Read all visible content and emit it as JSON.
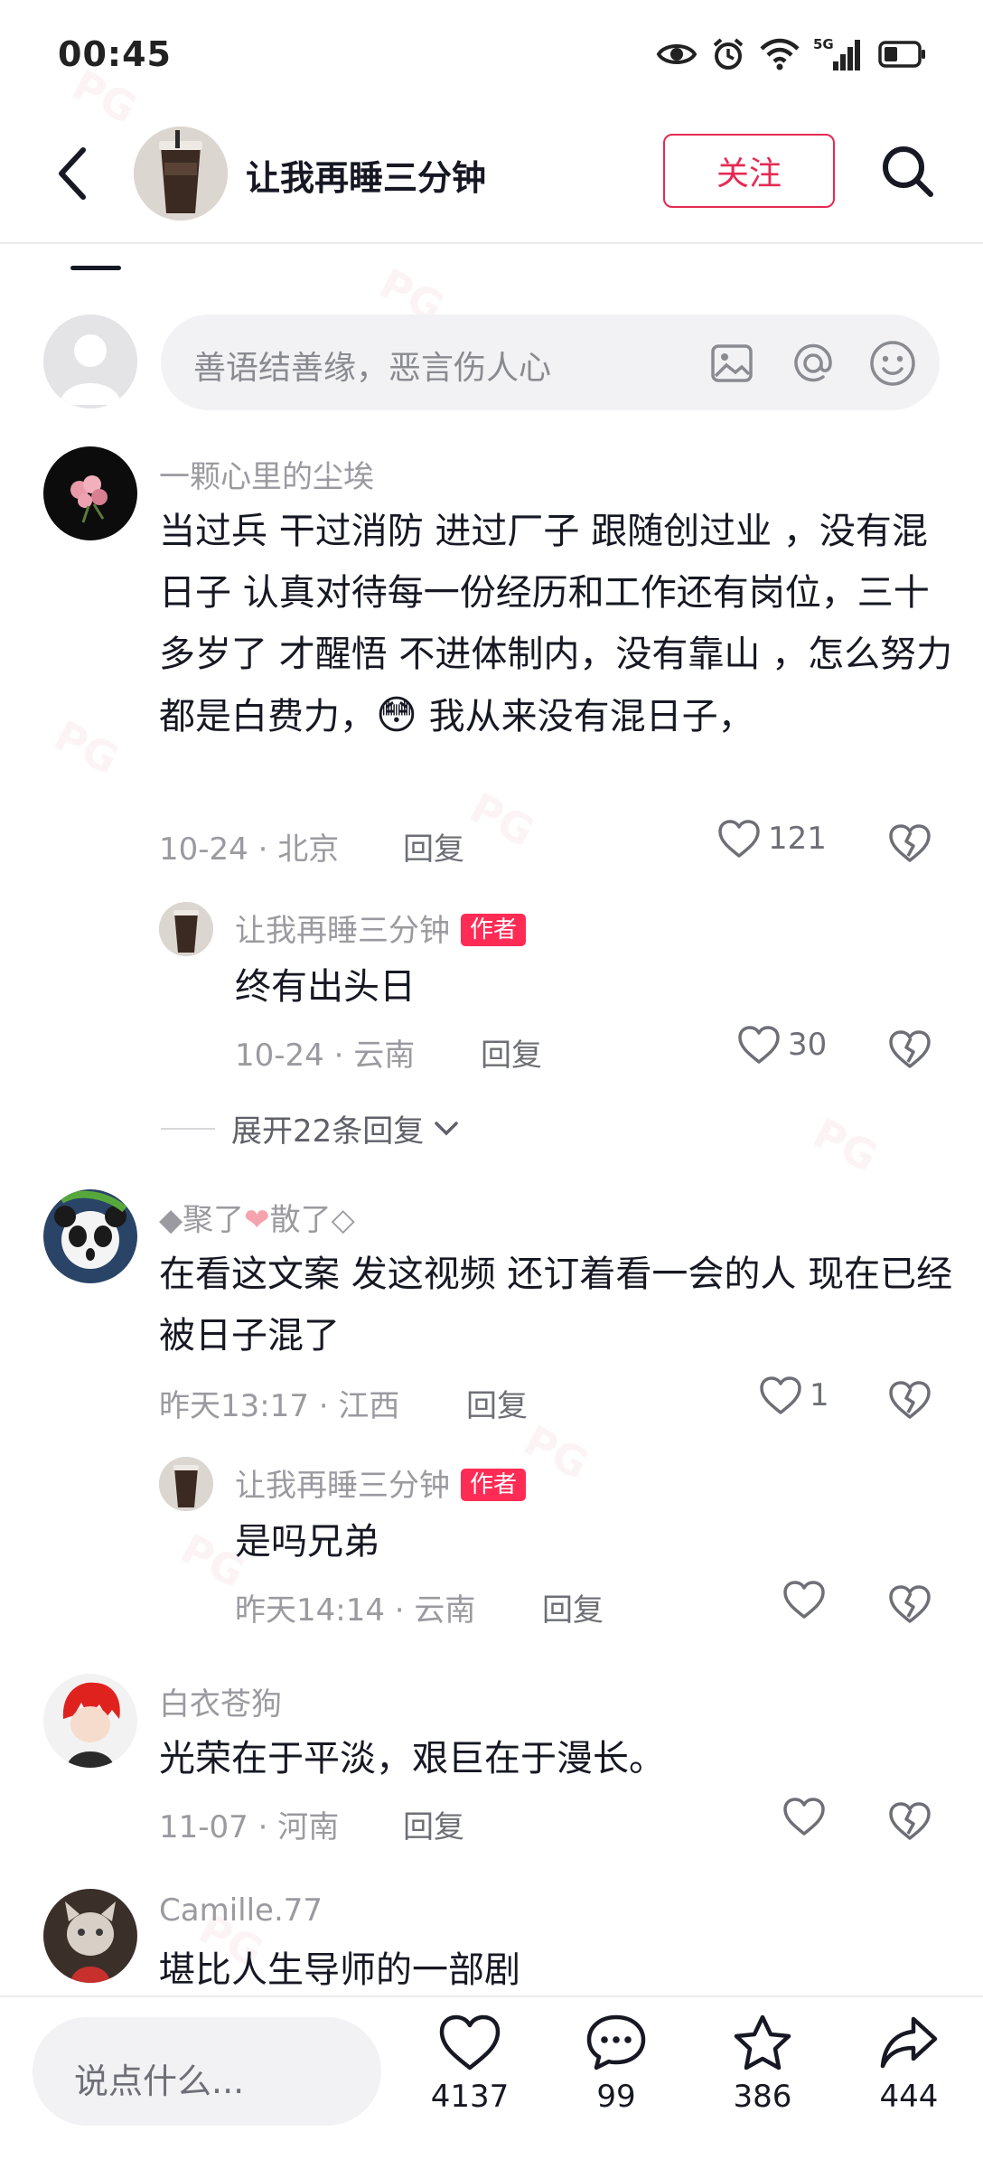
{
  "status_bar": {
    "time": "00:45",
    "icons": [
      "eye-icon",
      "alarm-icon",
      "wifi-icon",
      "signal-5g-icon",
      "battery-icon"
    ],
    "network": "5G"
  },
  "header": {
    "title": "让我再睡三分钟",
    "follow_label": "关注",
    "back_icon": "chevron-left-icon",
    "search_icon": "search-icon"
  },
  "comment_input": {
    "placeholder": "善语结善缘，恶言伤人心",
    "icons": [
      "image-icon",
      "at-icon",
      "emoji-icon"
    ]
  },
  "comments": [
    {
      "name": "一颗心里的尘埃",
      "text_before_emoji": "当过兵 干过消防 进过厂子 跟随创过业 ，没有混日子 认真对待每一份经历和工作还有岗位，三十多岁了 才醒悟 不进体制内，没有靠山 ，怎么努力都是白费力，",
      "emoji": "😳",
      "text_after_emoji": " 我从来没有混日子，",
      "date": "10-24",
      "location": "北京",
      "reply_label": "回复",
      "likes": "121",
      "replies": [
        {
          "name": "让我再睡三分钟",
          "badge": "作者",
          "text": "终有出头日",
          "date": "10-24",
          "location": "云南",
          "reply_label": "回复",
          "likes": "30"
        }
      ],
      "expand_label": "展开22条回复"
    },
    {
      "name_prefix": "◆聚了",
      "name_heart": "❤",
      "name_suffix": "散了◇",
      "text": "在看这文案 发这视频 还订着看一会的人 现在已经被日子混了",
      "date": "昨天13:17",
      "location": "江西",
      "reply_label": "回复",
      "likes": "1",
      "replies": [
        {
          "name": "让我再睡三分钟",
          "badge": "作者",
          "text": "是吗兄弟",
          "date": "昨天14:14",
          "location": "云南",
          "reply_label": "回复",
          "likes": ""
        }
      ]
    },
    {
      "name": "白衣苍狗",
      "text": "光荣在于平淡，艰巨在于漫长。",
      "date": "11-07",
      "location": "河南",
      "reply_label": "回复",
      "likes": ""
    },
    {
      "name": "Camille.77",
      "text": "堪比人生导师的一部剧"
    }
  ],
  "bottom_bar": {
    "input_placeholder": "说点什么...",
    "actions": [
      {
        "icon": "heart-icon",
        "count": "4137"
      },
      {
        "icon": "comment-icon",
        "count": "99"
      },
      {
        "icon": "star-icon",
        "count": "386"
      },
      {
        "icon": "share-icon",
        "count": "444"
      }
    ]
  },
  "colors": {
    "accent": "#fe2c55",
    "follow_border": "#e62a52",
    "text_primary": "#161823",
    "text_secondary": "#9a9aa0"
  }
}
